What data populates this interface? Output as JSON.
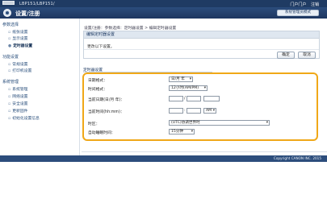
{
  "header": {
    "printer_name": "LBP151/LBP151/",
    "links": [
      "门户门户",
      "注销"
    ],
    "page_title": "设置/注册",
    "user_button": "系统管理员模式"
  },
  "sidebar": {
    "groups": [
      {
        "title": "参数选择",
        "items": [
          "纸张设置",
          "显示设置",
          "定时器设置"
        ]
      },
      {
        "title": "功能设置",
        "items": [
          "常规设置",
          "打印机设置"
        ]
      },
      {
        "title": "系统管理",
        "items": [
          "系统管理",
          "网络设置",
          "安全设置",
          "更新固件",
          "初始化设置信息"
        ]
      }
    ],
    "active_item": "定时器设置"
  },
  "breadcrumb": "设置/注册：参数选择：定时器设置 > 编辑定时器设置",
  "notice": {
    "header": "编辑定时器设置",
    "message": "更改以下设置。",
    "ok_label": "确定",
    "cancel_label": "取消"
  },
  "settings": {
    "section_title": "定时器设置",
    "rows": [
      {
        "label": "日期格式：",
        "value": "日/月 年"
      },
      {
        "label": "时间格式：",
        "value": "12小时(AM/PM)"
      },
      {
        "label": "当前日期(日/月 年)："
      },
      {
        "label": "当前时间(hh:mm)：",
        "ampm": "AM"
      },
      {
        "label": "时区：",
        "value": "(UTC)协调世界时"
      },
      {
        "label": "自动睡眠时间：",
        "value": "15分钟"
      }
    ]
  },
  "footer": {
    "copyright": "Copyright CANON INC. 2015"
  },
  "colors": {
    "header_bg": "#1f3b63",
    "accent_highlight": "#f0a818"
  }
}
